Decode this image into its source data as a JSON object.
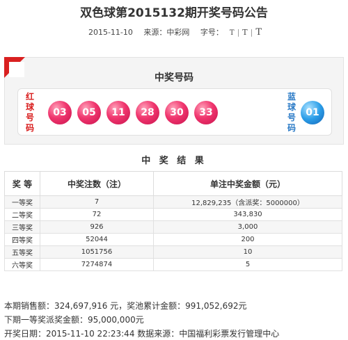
{
  "header": {
    "title": "双色球第2015132期开奖号码公告",
    "date": "2015-11-10",
    "source": "来源：中彩网",
    "font_label": "字号：",
    "font_sizes": [
      "T",
      "T",
      "T"
    ],
    "separator": "|"
  },
  "draw": {
    "title": "中奖号码",
    "red_label": [
      "红",
      "球",
      "号",
      "码"
    ],
    "blue_label": [
      "蓝",
      "球",
      "号",
      "码"
    ],
    "red_balls": [
      "03",
      "05",
      "11",
      "28",
      "30",
      "33"
    ],
    "blue_ball": "01",
    "colors": {
      "red": "#f0366e",
      "blue": "#2b9ee8",
      "accent": "#d92020"
    }
  },
  "results": {
    "title": "中 奖 结 果",
    "headers": [
      "奖 等",
      "中奖注数（注）",
      "单注中奖金额（元）"
    ],
    "rows": [
      {
        "level": "一等奖",
        "count": "7",
        "amount": "12,829,235（含派奖：5000000）"
      },
      {
        "level": "二等奖",
        "count": "72",
        "amount": "343,830"
      },
      {
        "level": "三等奖",
        "count": "926",
        "amount": "3,000"
      },
      {
        "level": "四等奖",
        "count": "52044",
        "amount": "200"
      },
      {
        "level": "五等奖",
        "count": "1051756",
        "amount": "10"
      },
      {
        "level": "六等奖",
        "count": "7274874",
        "amount": "5"
      }
    ]
  },
  "summary": {
    "sales": "本期销售额：324,697,916 元，奖池累计金额：991,052,692元",
    "next_prize": "下期一等奖派奖金额：95,000,000元",
    "draw_date": "开奖日期：2015-11-10 22:23:44 数据来源：中国福利彩票发行管理中心"
  }
}
